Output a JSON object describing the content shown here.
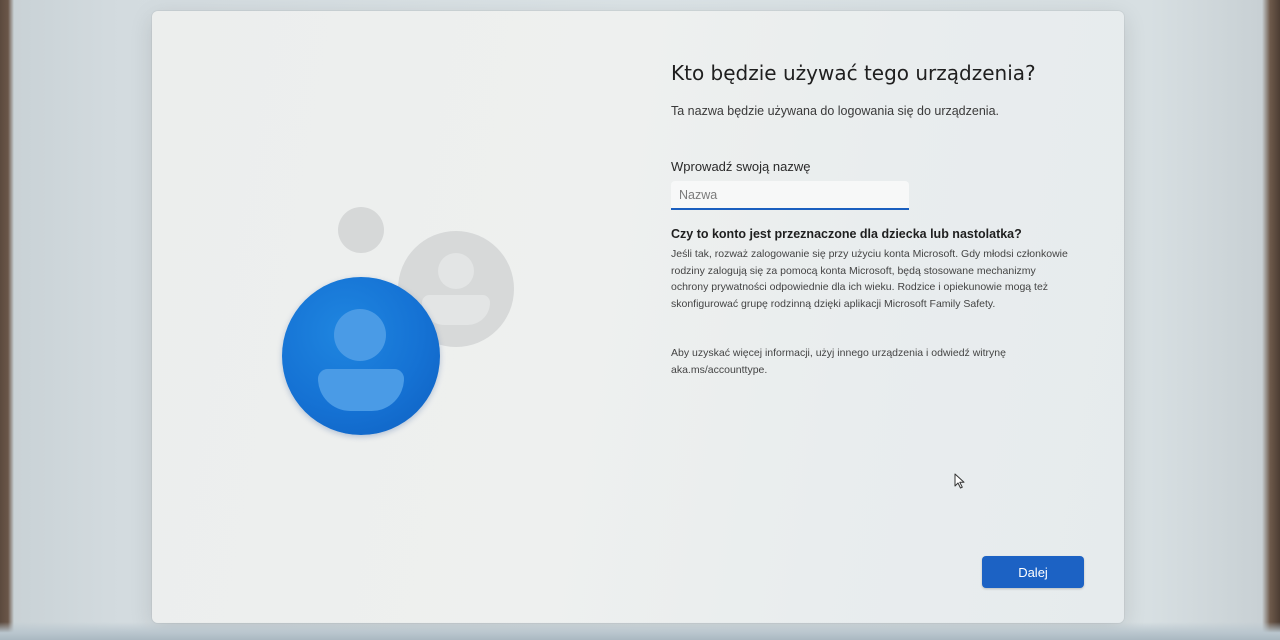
{
  "page": {
    "title": "Kto będzie używać tego urządzenia?",
    "subtitle": "Ta nazwa będzie używana do logowania się do urządzenia."
  },
  "name_field": {
    "label": "Wprowadź swoją nazwę",
    "placeholder": "Nazwa",
    "value": ""
  },
  "child_account": {
    "question": "Czy to konto jest przeznaczone dla dziecka lub nastolatka?",
    "paragraph1": "Jeśli tak, rozważ zalogowanie się przy użyciu konta Microsoft. Gdy młodsi członkowie rodziny zalogują się za pomocą konta Microsoft, będą stosowane mechanizmy ochrony prywatności odpowiednie dla ich wieku. Rodzice i opiekunowie mogą też skonfigurować grupę rodzinną dzięki aplikacji Microsoft Family Safety.",
    "paragraph2": "Aby uzyskać więcej informacji, użyj innego urządzenia i odwiedź witrynę aka.ms/accounttype."
  },
  "actions": {
    "next_label": "Dalej"
  },
  "colors": {
    "accent": "#1c62c4",
    "avatar_blue": "#1572d4",
    "avatar_grey": "#d7d9d9"
  },
  "icons": {
    "avatar": "user-avatar-icon",
    "cursor": "mouse-pointer-icon"
  }
}
